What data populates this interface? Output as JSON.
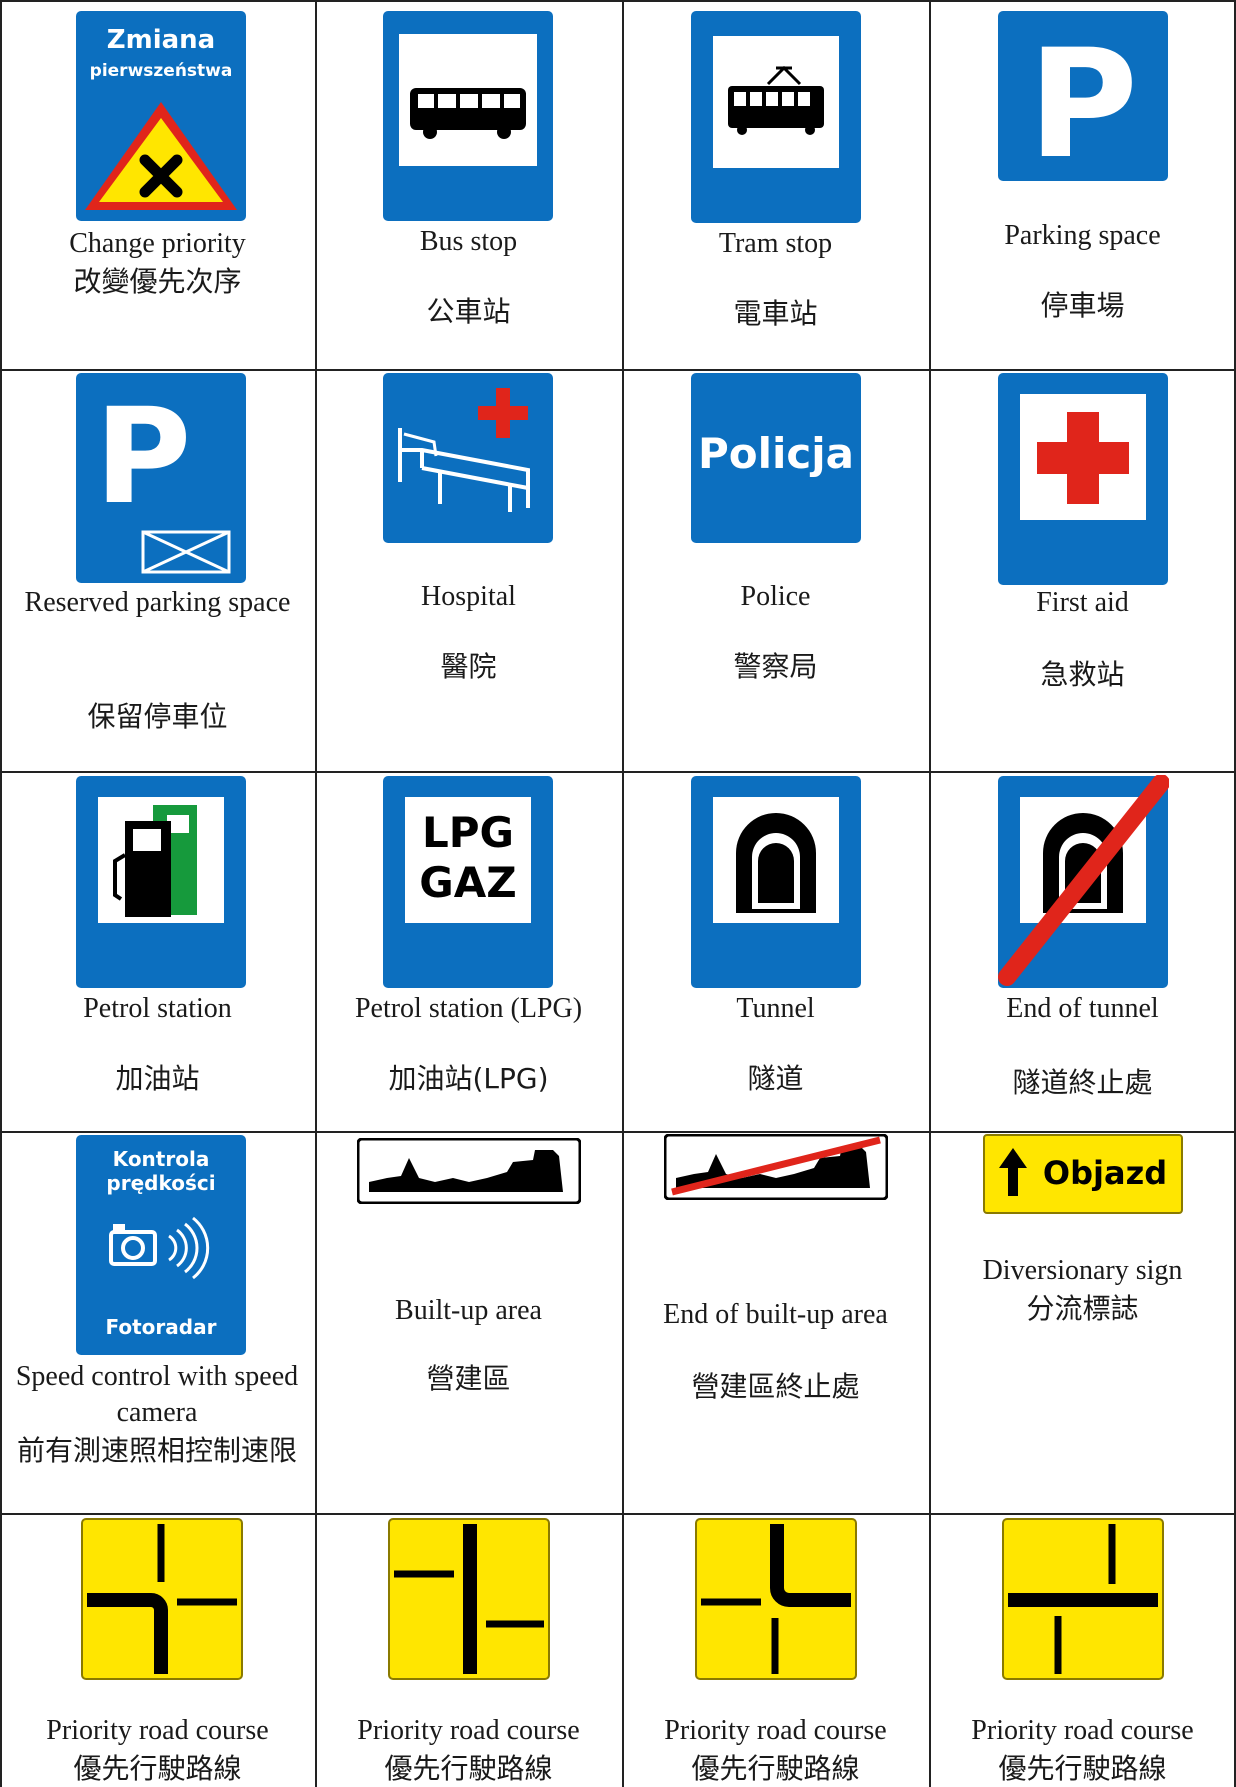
{
  "signs": [
    {
      "en": "Change priority",
      "zh": "改變優先次序",
      "sign_text": [
        "Zmiana",
        "pierwszeństwa"
      ],
      "icon": "change-priority-sign"
    },
    {
      "en": "Bus stop",
      "zh": "公車站",
      "icon": "bus-stop-sign"
    },
    {
      "en": "Tram stop",
      "zh": "電車站",
      "icon": "tram-stop-sign"
    },
    {
      "en": "Parking space",
      "zh": "停車場",
      "icon": "parking-sign",
      "sign_text": [
        "P"
      ]
    },
    {
      "en": "Reserved parking space",
      "zh": "保留停車位",
      "icon": "reserved-parking-sign",
      "sign_text": [
        "P"
      ]
    },
    {
      "en": "Hospital",
      "zh": "醫院",
      "icon": "hospital-sign"
    },
    {
      "en": "Police",
      "zh": "警察局",
      "icon": "police-sign",
      "sign_text": [
        "Policja"
      ]
    },
    {
      "en": "First aid",
      "zh": "急救站",
      "icon": "first-aid-sign"
    },
    {
      "en": "Petrol station",
      "zh": "加油站",
      "icon": "petrol-station-sign"
    },
    {
      "en": "Petrol station (LPG)",
      "zh": "加油站(LPG)",
      "icon": "lpg-station-sign",
      "sign_text": [
        "LPG",
        "GAZ"
      ]
    },
    {
      "en": "Tunnel",
      "zh": "隧道",
      "icon": "tunnel-sign"
    },
    {
      "en": "End of tunnel",
      "zh": "隧道終止處",
      "icon": "end-of-tunnel-sign"
    },
    {
      "en": "Speed control with speed camera",
      "zh": "前有測速照相控制速限",
      "icon": "speed-camera-sign",
      "sign_text": [
        "Kontrola",
        "prędkości",
        "Fotoradar"
      ]
    },
    {
      "en": "Built-up area",
      "zh": "營建區",
      "icon": "built-up-area-sign"
    },
    {
      "en": "End of built-up area",
      "zh": "營建區終止處",
      "icon": "end-of-built-up-area-sign"
    },
    {
      "en": "Diversionary sign",
      "zh": "分流標誌",
      "icon": "diversion-sign",
      "sign_text": [
        "Objazd"
      ]
    },
    {
      "en": "Priority road course",
      "zh": "優先行駛路線",
      "icon": "priority-road-course-sign-1"
    },
    {
      "en": "Priority road course",
      "zh": "優先行駛路線",
      "icon": "priority-road-course-sign-2"
    },
    {
      "en": "Priority road course",
      "zh": "優先行駛路線",
      "icon": "priority-road-course-sign-3"
    },
    {
      "en": "Priority road course",
      "zh": "優先行駛路線",
      "icon": "priority-road-course-sign-4"
    }
  ],
  "colors": {
    "blue": "#0c6fbf",
    "yellow": "#ffe600",
    "red": "#e0251b",
    "green": "#169a3c"
  }
}
